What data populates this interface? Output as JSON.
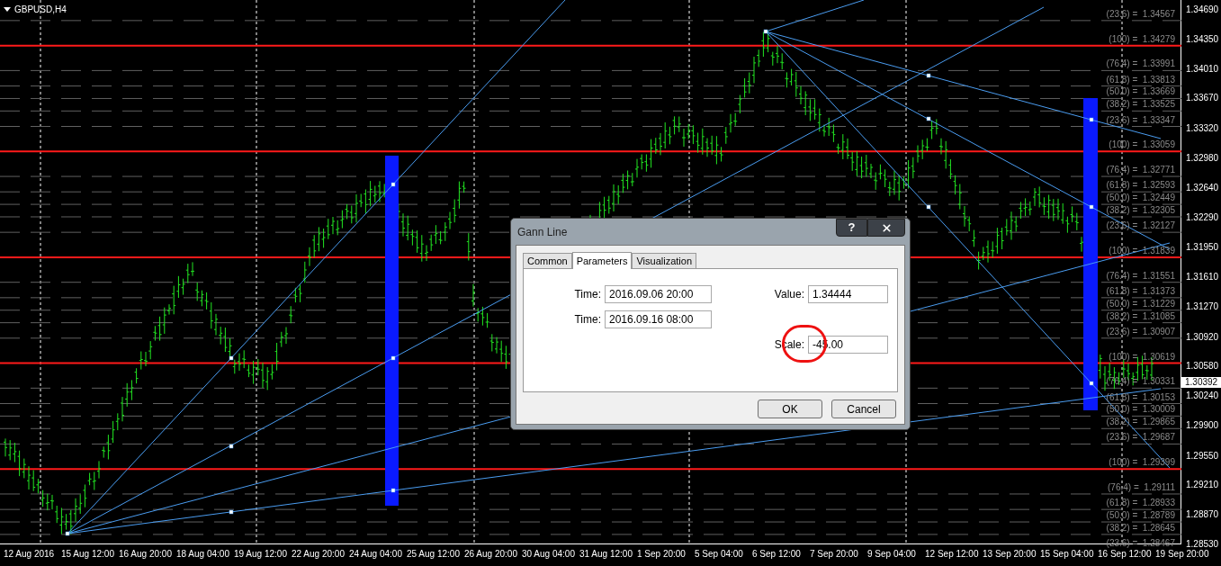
{
  "chart": {
    "title": "GBPUSD,H4",
    "price_axis": [
      "1.34690",
      "1.34350",
      "1.34010",
      "1.33670",
      "1.33320",
      "1.32980",
      "1.32640",
      "1.32290",
      "1.31950",
      "1.31610",
      "1.31270",
      "1.30920",
      "1.30580",
      "1.30240",
      "1.29900",
      "1.29550",
      "1.29210",
      "1.28870",
      "1.28530"
    ],
    "current_price": "1.30392",
    "time_axis": [
      "12 Aug 2016",
      "15 Aug 12:00",
      "16 Aug 20:00",
      "18 Aug 04:00",
      "19 Aug 12:00",
      "22 Aug 20:00",
      "24 Aug 04:00",
      "25 Aug 12:00",
      "26 Aug 20:00",
      "30 Aug 04:00",
      "31 Aug 12:00",
      "1 Sep 20:00",
      "5 Sep 04:00",
      "6 Sep 12:00",
      "7 Sep 20:00",
      "9 Sep 04:00",
      "12 Sep 12:00",
      "13 Sep 20:00",
      "15 Sep 04:00",
      "16 Sep 12:00",
      "19 Sep 20:00"
    ],
    "levels": [
      {
        "text": "(23.6) =  1.34567",
        "kind": "fib"
      },
      {
        "text": "(100) =  1.34279",
        "kind": "base"
      },
      {
        "text": "(76.4) =  1.33991",
        "kind": "fib"
      },
      {
        "text": "(61.8) =  1.33813",
        "kind": "fib"
      },
      {
        "text": "(50.0) =  1.33669",
        "kind": "fib"
      },
      {
        "text": "(38.2) =  1.33525",
        "kind": "fib"
      },
      {
        "text": "(23.6) =  1.33347",
        "kind": "fib"
      },
      {
        "text": "(100) =  1.33059",
        "kind": "base"
      },
      {
        "text": "(76.4) =  1.32771",
        "kind": "fib"
      },
      {
        "text": "(61.8) =  1.32593",
        "kind": "fib"
      },
      {
        "text": "(50.0) =  1.32449",
        "kind": "fib"
      },
      {
        "text": "(38.2) =  1.32305",
        "kind": "fib"
      },
      {
        "text": "(23.6) =  1.32127",
        "kind": "fib"
      },
      {
        "text": "(100) =  1.31839",
        "kind": "base"
      },
      {
        "text": "(76.4) =  1.31551",
        "kind": "fib"
      },
      {
        "text": "(61.8) =  1.31373",
        "kind": "fib"
      },
      {
        "text": "(50.0) =  1.31229",
        "kind": "fib"
      },
      {
        "text": "(38.2) =  1.31085",
        "kind": "fib"
      },
      {
        "text": "(23.6) =  1.30907",
        "kind": "fib"
      },
      {
        "text": "(100) =  1.30619",
        "kind": "base"
      },
      {
        "text": "(76.4) =  1.30331",
        "kind": "fib"
      },
      {
        "text": "(61.8) =  1.30153",
        "kind": "fib"
      },
      {
        "text": "(50.0) =  1.30009",
        "kind": "fib"
      },
      {
        "text": "(38.2) =  1.29865",
        "kind": "fib"
      },
      {
        "text": "(23.6) =  1.29687",
        "kind": "fib"
      },
      {
        "text": "(100) =  1.29399",
        "kind": "base"
      },
      {
        "text": "(76.4) =  1.29111",
        "kind": "fib"
      },
      {
        "text": "(61.8) =  1.28933",
        "kind": "fib"
      },
      {
        "text": "(50.0) =  1.28789",
        "kind": "fib"
      },
      {
        "text": "(38.2) =  1.28645",
        "kind": "fib"
      },
      {
        "text": "(23.6) =  1.28467",
        "kind": "fib"
      }
    ]
  },
  "dialog": {
    "title": "Gann Line",
    "help_button": "?",
    "tabs": [
      {
        "label": "Common",
        "selected": false
      },
      {
        "label": "Parameters",
        "selected": true
      },
      {
        "label": "Visualization",
        "selected": false
      }
    ],
    "left_fields": [
      {
        "label": "Time:",
        "value": "2016.09.06 20:00",
        "highlighted": false
      },
      {
        "label": "Time:",
        "value": "2016.09.16 08:00",
        "highlighted": false
      }
    ],
    "right_fields": [
      {
        "label": "Value:",
        "value": "1.34444",
        "highlighted": false
      },
      {
        "label": "Scale:",
        "value": "-45.00",
        "highlighted": true
      }
    ],
    "buttons": [
      "OK",
      "Cancel"
    ]
  }
}
